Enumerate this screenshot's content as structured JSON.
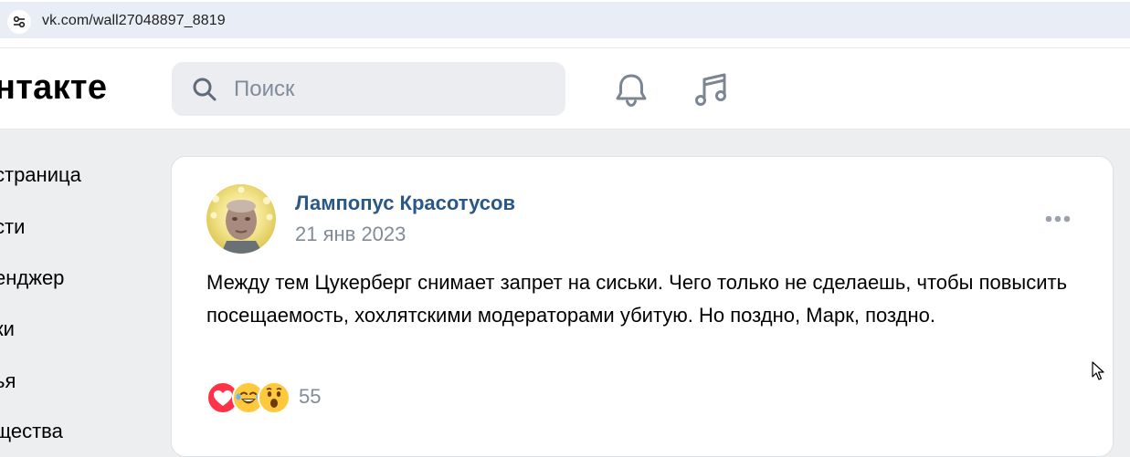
{
  "browser": {
    "url": "vk.com/wall27048897_8819",
    "site_info_icon": "tune-icon"
  },
  "header": {
    "logo_text": "нтакте",
    "search_placeholder": "Поиск",
    "icons": [
      "bell-icon",
      "music-icon"
    ]
  },
  "sidebar": {
    "items": [
      {
        "label": "страница"
      },
      {
        "label": "сти"
      },
      {
        "label": "енджер"
      },
      {
        "label": "ки"
      },
      {
        "label": "ья"
      },
      {
        "label": "щества"
      }
    ]
  },
  "post": {
    "author": "Лампопус Красотусов",
    "date": "21 янв 2023",
    "text": "Между тем Цукерберг снимает запрет на сиськи. Чего только не сделаешь, чтобы повысить посещаемость, хохлятскими модераторами убитую. Но поздно, Марк, поздно.",
    "reactions": [
      "heart-icon",
      "laughing-face-icon",
      "surprised-face-icon"
    ],
    "reaction_count": "55"
  },
  "colors": {
    "page_bg": "#edeef0",
    "card_bg": "#ffffff",
    "author_link": "#2a5885",
    "secondary_text": "#818c99",
    "search_bg": "#ebedf0"
  }
}
